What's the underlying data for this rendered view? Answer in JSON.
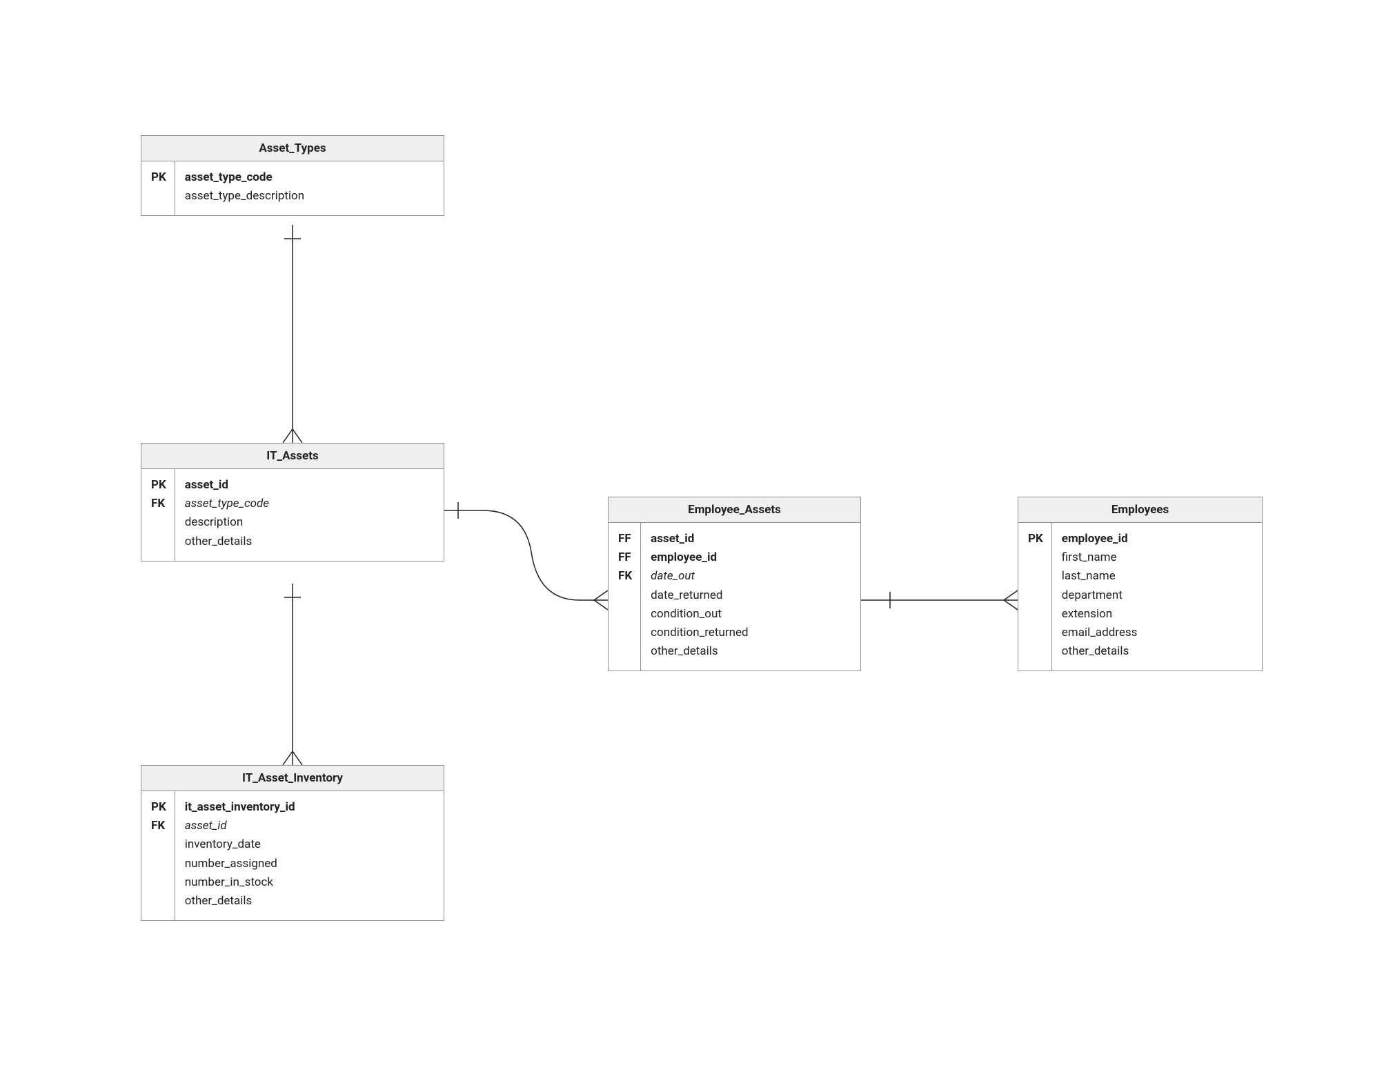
{
  "entities": {
    "asset_types": {
      "title": "Asset_Types",
      "keys": [
        "PK",
        ""
      ],
      "attrs": [
        {
          "text": "asset_type_code",
          "bold": true
        },
        {
          "text": "asset_type_description"
        }
      ]
    },
    "it_assets": {
      "title": "IT_Assets",
      "keys": [
        "PK",
        "FK",
        "",
        ""
      ],
      "attrs": [
        {
          "text": "asset_id",
          "bold": true
        },
        {
          "text": "asset_type_code",
          "italic": true
        },
        {
          "text": "description"
        },
        {
          "text": "other_details"
        }
      ]
    },
    "it_asset_inventory": {
      "title": "IT_Asset_Inventory",
      "keys": [
        "PK",
        "FK",
        "",
        "",
        "",
        ""
      ],
      "attrs": [
        {
          "text": "it_asset_inventory_id",
          "bold": true
        },
        {
          "text": "asset_id",
          "italic": true
        },
        {
          "text": "inventory_date"
        },
        {
          "text": "number_assigned"
        },
        {
          "text": "number_in_stock"
        },
        {
          "text": "other_details"
        }
      ]
    },
    "employee_assets": {
      "title": "Employee_Assets",
      "keys": [
        "FF",
        "FF",
        "FK",
        "",
        "",
        "",
        ""
      ],
      "attrs": [
        {
          "text": "asset_id",
          "bold": true
        },
        {
          "text": "employee_id",
          "bold": true
        },
        {
          "text": "date_out",
          "italic": true
        },
        {
          "text": "date_returned"
        },
        {
          "text": "condition_out"
        },
        {
          "text": "condition_returned"
        },
        {
          "text": "other_details"
        }
      ]
    },
    "employees": {
      "title": "Employees",
      "keys": [
        "PK",
        "",
        "",
        "",
        "",
        "",
        ""
      ],
      "attrs": [
        {
          "text": "employee_id",
          "bold": true
        },
        {
          "text": "first_name"
        },
        {
          "text": "last_name"
        },
        {
          "text": "department"
        },
        {
          "text": "extension"
        },
        {
          "text": "email_address"
        },
        {
          "text": "other_details"
        }
      ]
    }
  }
}
